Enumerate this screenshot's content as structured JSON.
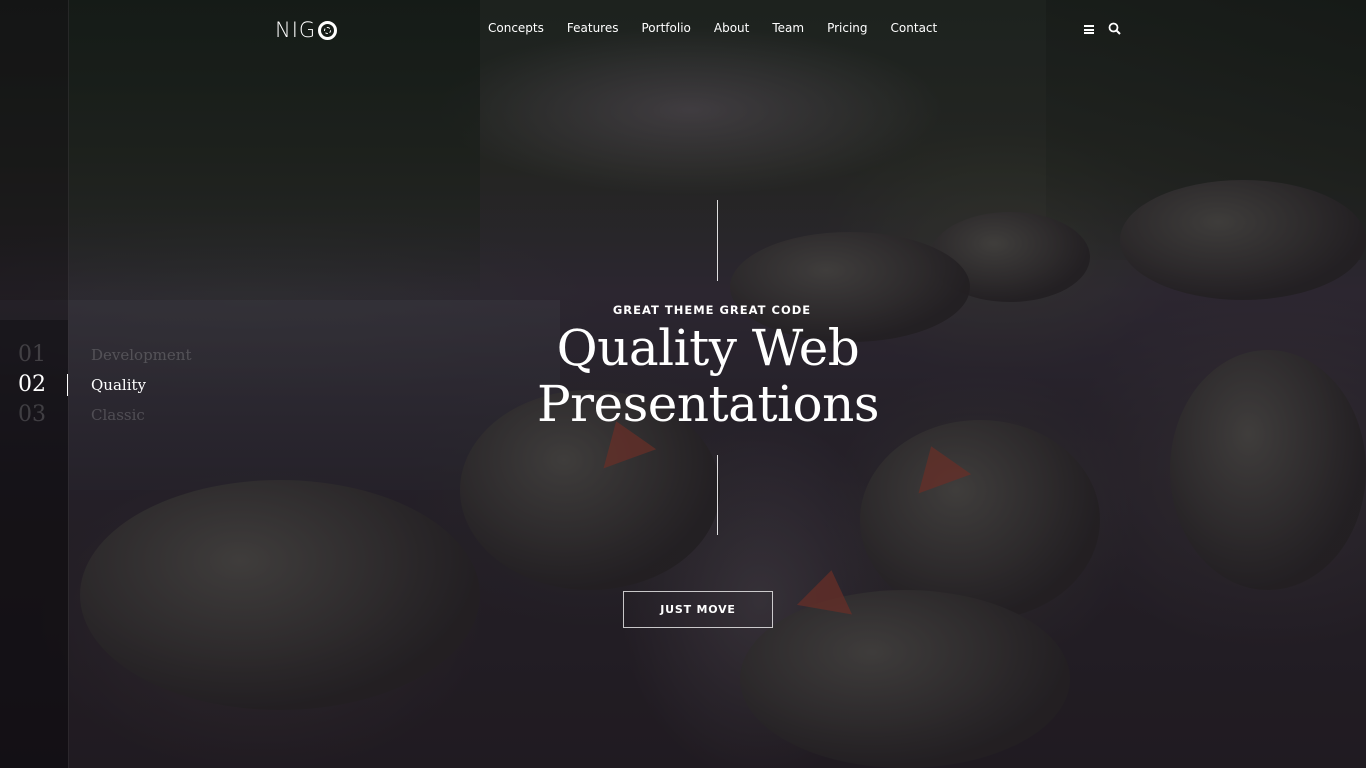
{
  "header": {
    "logo_text": "NIG",
    "nav": [
      {
        "label": "Concepts"
      },
      {
        "label": "Features"
      },
      {
        "label": "Portfolio"
      },
      {
        "label": "About"
      },
      {
        "label": "Team"
      },
      {
        "label": "Pricing"
      },
      {
        "label": "Contact"
      }
    ],
    "icons": [
      "menu-icon",
      "search-icon"
    ]
  },
  "slides": [
    {
      "number": "01",
      "label": "Development",
      "active": false
    },
    {
      "number": "02",
      "label": "Quality",
      "active": true
    },
    {
      "number": "03",
      "label": "Classic",
      "active": false
    }
  ],
  "hero": {
    "eyebrow": "GREAT THEME GREAT CODE",
    "headline_line1": "Quality Web",
    "headline_line2": "Presentations",
    "cta_label": "JUST MOVE"
  },
  "colors": {
    "text": "#ffffff",
    "inactive_text": "rgba(255,255,255,0.18)",
    "overlay": "#1b1719"
  }
}
